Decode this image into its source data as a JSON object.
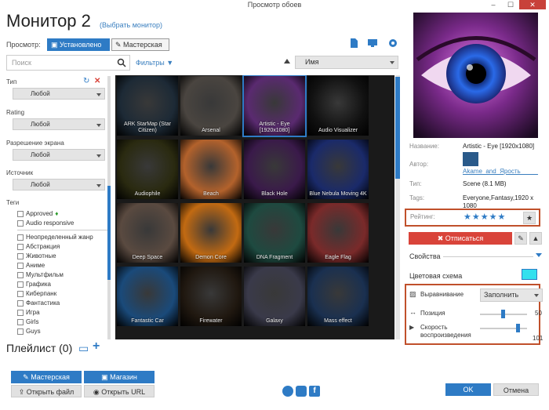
{
  "window": {
    "title": "Просмотр обоев",
    "min": "–",
    "max": "☐",
    "close": "✕"
  },
  "header": {
    "title": "Монитор 2",
    "select_monitor": "(Выбрать монитор)",
    "view_label": "Просмотр:",
    "tab_installed": "Установлено",
    "tab_workshop": "Мастерская"
  },
  "toolbar": {
    "search_placeholder": "Поиск",
    "filters": "Фильтры",
    "sort_value": "Имя"
  },
  "filters": {
    "type_label": "Тип",
    "type_value": "Любой",
    "rating_label": "Rating",
    "rating_value": "Любой",
    "resolution_label": "Разрешение экрана",
    "resolution_value": "Любой",
    "source_label": "Источник",
    "source_value": "Любой",
    "tags_label": "Теги",
    "checkboxes": [
      "Approved",
      "Audio responsive",
      "Неопределенный жанр",
      "Абстракция",
      "Животные",
      "Аниме",
      "Мультфильм",
      "Графика",
      "Киберпанк",
      "Фантастика",
      "Игра",
      "Girls",
      "Guys"
    ]
  },
  "grid": [
    {
      "caption": "ARK StarMap (Star Citizen)",
      "bg": "#1d2a36"
    },
    {
      "caption": "Arsenal",
      "bg": "#4a4540"
    },
    {
      "caption": "Artistic - Eye [1920x1080]",
      "bg": "#5a2a70"
    },
    {
      "caption": "Audio Visualizer",
      "bg": "#111111"
    },
    {
      "caption": "Audiophile",
      "bg": "#2a2a10"
    },
    {
      "caption": "Beach",
      "bg": "#b3622c"
    },
    {
      "caption": "Black Hole",
      "bg": "#3a1a4a"
    },
    {
      "caption": "Blue Nebula Moving 4K",
      "bg": "#1a2a6a"
    },
    {
      "caption": "Deep Space",
      "bg": "#5a4a40"
    },
    {
      "caption": "Demon Core",
      "bg": "#c26a12"
    },
    {
      "caption": "DNA Fragment",
      "bg": "#1e4a40"
    },
    {
      "caption": "Eagle Flag",
      "bg": "#7a2a2a"
    },
    {
      "caption": "Fantastic Car",
      "bg": "#1a4a7a"
    },
    {
      "caption": "Firewater",
      "bg": "#201810"
    },
    {
      "caption": "Galaxy",
      "bg": "#3a3a4a"
    },
    {
      "caption": "Mass effect",
      "bg": "#1a3050"
    }
  ],
  "playlist": {
    "label": "Плейлист (0)"
  },
  "bottom_buttons": {
    "workshop": "Мастерская",
    "shop": "Магазин",
    "open_file": "Открыть файл",
    "open_url": "Открыть URL",
    "ok": "OK",
    "cancel": "Отмена"
  },
  "details": {
    "name_label": "Название:",
    "name_value": "Artistic - Eye [1920x1080]",
    "author_label": "Автор:",
    "author_value": "Akame_and_Ярость_____",
    "type_label": "Тип:",
    "type_value": "Scene (8.1 MB)",
    "tags_label": "Tags:",
    "tags_value": "Everyone,Fantasy,1920 x 1080",
    "rating_label": "Рейтинг:",
    "rating_stars": "★★★★★",
    "unsubscribe": "Отписаться",
    "properties": "Свойства",
    "color_scheme": "Цветовая схема",
    "color_value": "#33e0ee",
    "alignment_label": "Выравнивание",
    "alignment_value": "Заполнить",
    "position_label": "Позиция",
    "position_value": "50",
    "speed_label": "Скорость воспроизведения",
    "speed_value": "101"
  }
}
